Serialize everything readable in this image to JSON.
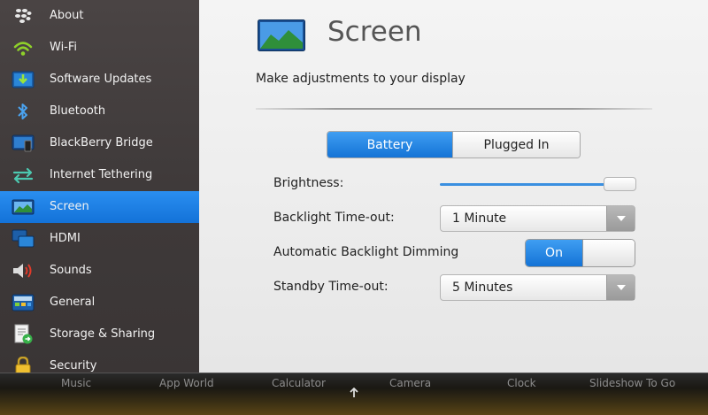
{
  "sidebar": {
    "items": [
      {
        "label": "About",
        "icon": "blackberry-logo-icon"
      },
      {
        "label": "Wi-Fi",
        "icon": "wifi-icon"
      },
      {
        "label": "Software Updates",
        "icon": "software-update-icon"
      },
      {
        "label": "Bluetooth",
        "icon": "bluetooth-icon"
      },
      {
        "label": "BlackBerry Bridge",
        "icon": "bridge-icon"
      },
      {
        "label": "Internet Tethering",
        "icon": "tethering-icon"
      },
      {
        "label": "Screen",
        "icon": "screen-icon",
        "active": true
      },
      {
        "label": "HDMI",
        "icon": "hdmi-icon"
      },
      {
        "label": "Sounds",
        "icon": "speaker-icon"
      },
      {
        "label": "General",
        "icon": "general-icon"
      },
      {
        "label": "Storage & Sharing",
        "icon": "storage-icon"
      },
      {
        "label": "Security",
        "icon": "lock-icon"
      }
    ]
  },
  "main": {
    "title": "Screen",
    "subtitle": "Make adjustments to your display",
    "power_tabs": {
      "battery": "Battery",
      "plugged_in": "Plugged In",
      "selected": "Battery"
    },
    "brightness": {
      "label": "Brightness:",
      "level": 0.95
    },
    "backlight_timeout": {
      "label": "Backlight Time-out:",
      "value": "1 Minute"
    },
    "auto_dimming": {
      "label": "Automatic Backlight Dimming",
      "value": "On"
    },
    "standby_timeout": {
      "label": "Standby Time-out:",
      "value": "5 Minutes"
    }
  },
  "dock": {
    "items": [
      "Music",
      "App World",
      "Calculator",
      "Camera",
      "Clock",
      "Slideshow To Go"
    ]
  },
  "colors": {
    "accent": "#1a7ee3",
    "sidebar_bg": "#443f3f"
  }
}
